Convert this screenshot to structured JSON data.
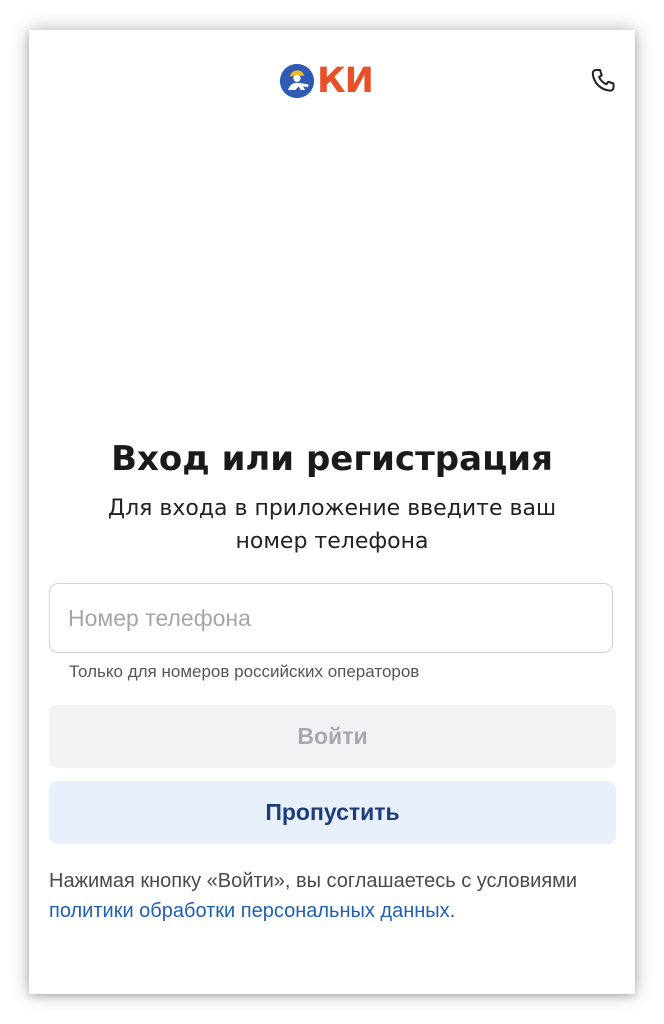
{
  "header": {
    "logo_text": "КИ",
    "logo_mark_icon": "worker-circle-icon",
    "phone_icon": "phone-icon",
    "colors": {
      "logo_blue": "#2f5bb5",
      "logo_orange": "#e8502a"
    }
  },
  "auth": {
    "title": "Вход или регистрация",
    "subtitle": "Для входа в приложение введите ваш номер телефона",
    "phone_placeholder": "Номер телефона",
    "phone_value": "",
    "phone_hint": "Только для номеров российских операторов",
    "login_label": "Войти",
    "skip_label": "Пропустить"
  },
  "terms": {
    "prefix": "Нажимая кнопку «Войти», вы соглашаетесь с условиями ",
    "link": "политики обработки персональных данных",
    "suffix": "."
  },
  "colors": {
    "login_bg": "#f1f2f4",
    "login_text": "#a6a9ad",
    "skip_bg": "#e8f0fc",
    "skip_text": "#1c3d7a",
    "link": "#1f5fb4"
  }
}
